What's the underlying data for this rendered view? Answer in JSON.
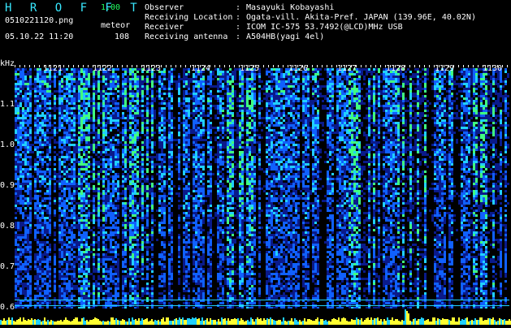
{
  "header": {
    "app_title": "H R O F F T",
    "version": "1.00",
    "file_name": "0510221120.png",
    "mode": "meteor",
    "date_time": "05.10.22 11:20",
    "count": "108"
  },
  "station": [
    {
      "label": "Observer",
      "sep": ":",
      "value": "Masayuki Kobayashi"
    },
    {
      "label": "Receiving Location",
      "sep": ":",
      "value": "Ogata-vill. Akita-Pref. JAPAN (139.96E, 40.02N)"
    },
    {
      "label": "Receiver",
      "sep": ":",
      "value": "ICOM IC-575 53.7492(@LCD)MHz USB"
    },
    {
      "label": "Receiving antenna",
      "sep": ":",
      "value": "A504HB(yagi 4el)"
    }
  ],
  "spectrogram": {
    "y_unit": "kHz",
    "y_ticks": [
      "1.1",
      "1.0",
      "0.9",
      "0.8",
      "0.7",
      "0.6"
    ],
    "x_ticks": [
      "1121",
      "1122",
      "1123",
      "1124",
      "1125",
      "1126",
      "1127",
      "1128",
      "1129",
      "1130"
    ],
    "colors": {
      "background": "#000000",
      "low": "#0a1a8a",
      "mid": "#1060ff",
      "high": "#20d0ff",
      "peak": "#40ff80",
      "histogram": "#ffff30",
      "baseline": "#20d0ff"
    }
  }
}
